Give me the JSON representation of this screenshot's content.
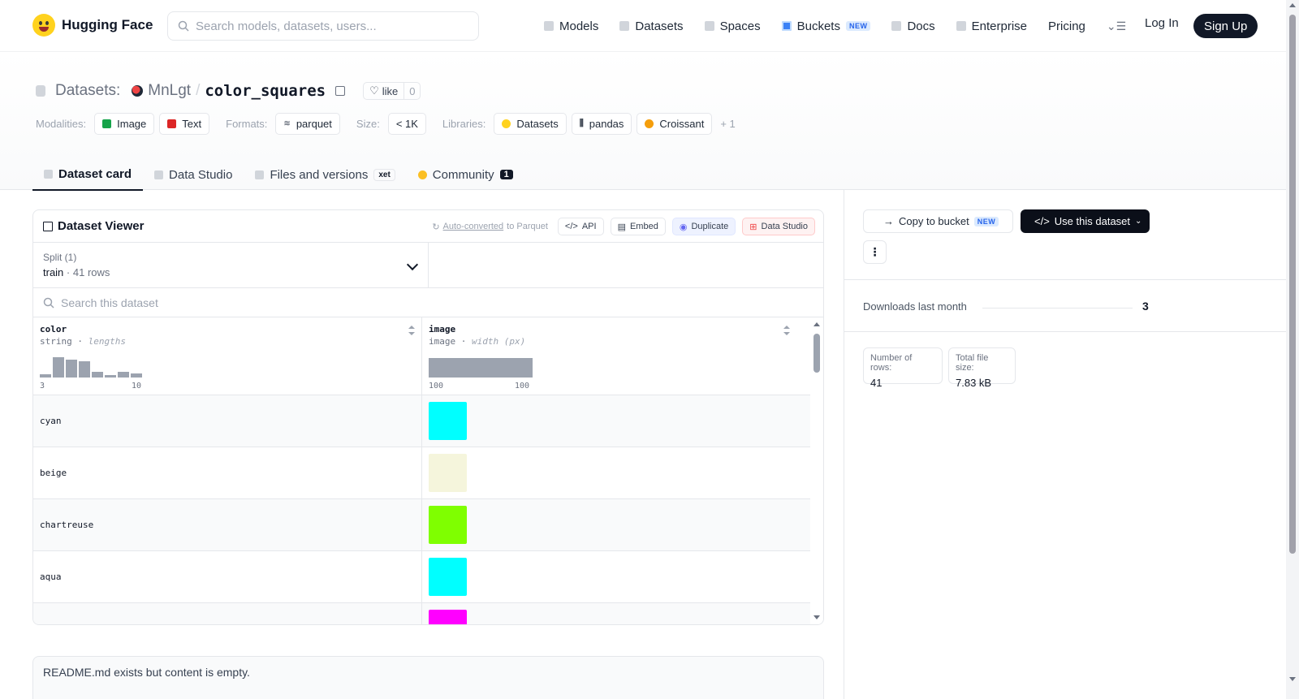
{
  "header": {
    "brand": "Hugging Face",
    "search_placeholder": "Search models, datasets, users...",
    "nav": [
      {
        "label": "Models",
        "icon": "cube-icon"
      },
      {
        "label": "Datasets",
        "icon": "database-icon"
      },
      {
        "label": "Spaces",
        "icon": "grid-icon"
      },
      {
        "label": "Buckets",
        "icon": "bucket-icon",
        "badge": "NEW"
      },
      {
        "label": "Docs",
        "icon": "book-icon"
      },
      {
        "label": "Enterprise",
        "icon": "building-icon"
      },
      {
        "label": "Pricing"
      }
    ],
    "login": "Log In",
    "signup": "Sign Up"
  },
  "title": {
    "prefix": "Datasets:",
    "owner": "MnLgt",
    "separator": "/",
    "name": "color_squares",
    "like_label": "like",
    "like_count": "0"
  },
  "meta": {
    "modalities_label": "Modalities:",
    "modalities": [
      "Image",
      "Text"
    ],
    "formats_label": "Formats:",
    "format": "parquet",
    "size_label": "Size:",
    "size": "< 1K",
    "libraries_label": "Libraries:",
    "libraries": [
      "Datasets",
      "pandas",
      "Croissant"
    ],
    "more": "+ 1"
  },
  "tabs": [
    {
      "label": "Dataset card",
      "active": true
    },
    {
      "label": "Data Studio"
    },
    {
      "label": "Files and versions",
      "badge": "xet"
    },
    {
      "label": "Community",
      "count": "1"
    }
  ],
  "viewer": {
    "title": "Dataset Viewer",
    "auto_converted": "Auto-converted",
    "auto_suffix": "to Parquet",
    "api": "API",
    "embed": "Embed",
    "duplicate": "Duplicate",
    "data_studio": "Data Studio",
    "split_label": "Split (1)",
    "split_value": "train",
    "split_rows": "41 rows",
    "search_placeholder": "Search this dataset",
    "columns": [
      {
        "name": "color",
        "type": "string",
        "stat": "lengths",
        "min": "3",
        "max": "10",
        "histogram": [
          0.15,
          0.95,
          0.85,
          0.75,
          0.25,
          0.1,
          0.25,
          0.2
        ]
      },
      {
        "name": "image",
        "type": "image",
        "stat": "width (px)",
        "min": "100",
        "max": "100"
      }
    ],
    "rows": [
      {
        "color": "cyan",
        "swatch": "#00ffff"
      },
      {
        "color": "beige",
        "swatch": "#f5f5dc"
      },
      {
        "color": "chartreuse",
        "swatch": "#7fff00"
      },
      {
        "color": "aqua",
        "swatch": "#00ffff"
      },
      {
        "color": "",
        "swatch": "#ff00ff"
      }
    ]
  },
  "readme": "README.md exists but content is empty.",
  "right": {
    "copy_bucket": "Copy to bucket",
    "copy_badge": "NEW",
    "use_dataset": "Use this dataset",
    "downloads_label": "Downloads last month",
    "downloads": "3",
    "rows_label": "Number of rows:",
    "rows": "41",
    "size_label": "Total file size:",
    "size": "7.83 kB"
  },
  "colors": {
    "accent_dark": "#0b0f19",
    "brand_yellow": "#ffd21e",
    "new_badge": "#2563eb"
  }
}
